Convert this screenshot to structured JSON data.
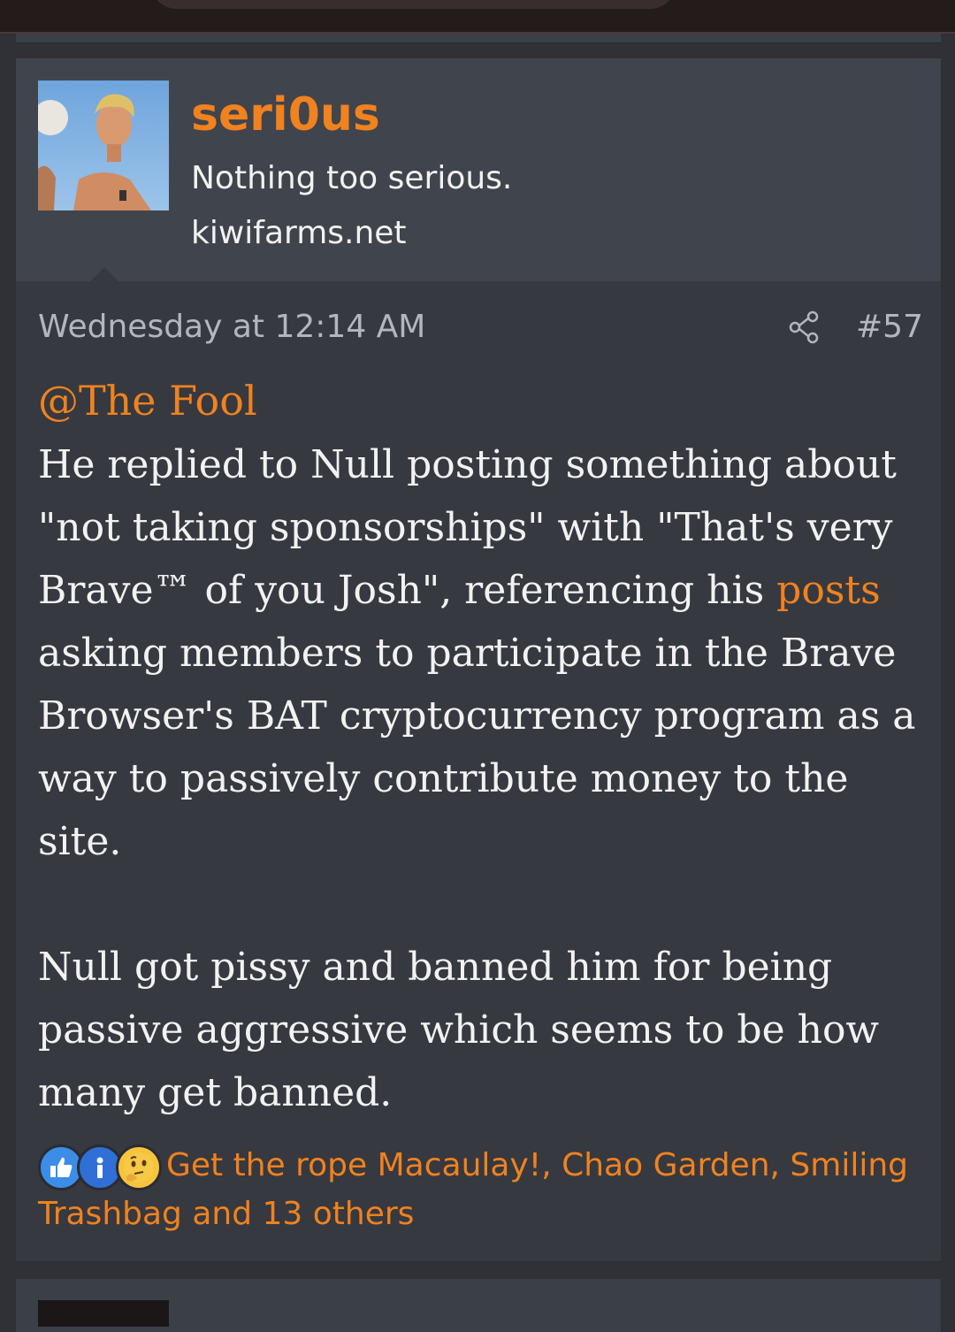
{
  "post": {
    "username": "seri0us",
    "user_title": "Nothing too serious.",
    "user_banner": "kiwifarms.net",
    "date": "Wednesday at 12:14 AM",
    "post_number": "#57",
    "mention": "@The Fool",
    "body_p1_before_link": "He replied to Null posting something about \"not taking sponsorships\" with \"That's very Brave™ of you Josh\", referencing his ",
    "body_p1_link": "posts",
    "body_p1_after_link": " asking members to participate in the Brave Browser's BAT cryptocurrency program as a way to passively contribute money to the site.",
    "body_p2": "Null got pissy and banned him for being passive aggressive which seems to be how many get banned.",
    "reactions_text": "Get the rope Macaulay!, Chao Garden, Smiling Trashbag and 13 others",
    "reaction_icons": [
      "thumbs-up-icon",
      "info-icon",
      "thinking-face-icon"
    ]
  },
  "colors": {
    "accent": "#f0821f",
    "card_bg": "#363940",
    "userblock_bg": "#40444c",
    "text": "#f2f2f2",
    "muted": "#b3b6bc"
  }
}
